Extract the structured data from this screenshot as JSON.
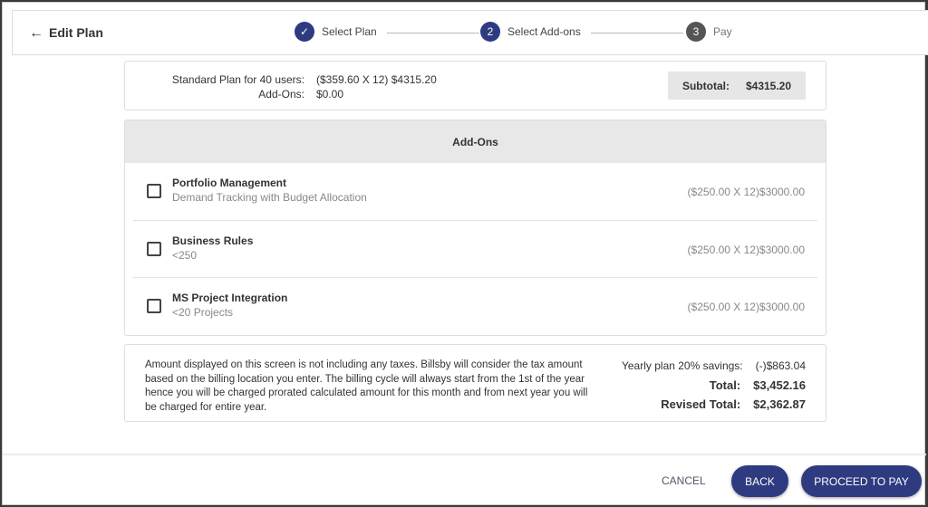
{
  "header": {
    "back_label": "Edit Plan",
    "steps": [
      {
        "num": "✓",
        "label": "Select Plan"
      },
      {
        "num": "2",
        "label": "Select Add-ons"
      },
      {
        "num": "3",
        "label": "Pay"
      }
    ]
  },
  "summary": {
    "plan_label": "Standard Plan for 40 users:",
    "plan_value": "($359.60 X 12) $4315.20",
    "addons_label": "Add-Ons:",
    "addons_value": "$0.00",
    "subtotal_label": "Subtotal:",
    "subtotal_value": "$4315.20"
  },
  "addons": {
    "title": "Add-Ons",
    "items": [
      {
        "name": "Portfolio Management",
        "desc": "Demand Tracking with Budget Allocation",
        "price": "($250.00 X 12)$3000.00",
        "checked": false
      },
      {
        "name": "Business Rules",
        "desc": "<250",
        "price": "($250.00 X 12)$3000.00",
        "checked": false
      },
      {
        "name": "MS Project Integration",
        "desc": "<20 Projects",
        "price": "($250.00 X 12)$3000.00",
        "checked": false
      }
    ]
  },
  "totals": {
    "note": "Amount displayed on this screen is not including any taxes. Billsby will consider the tax amount based on the billing location you enter. The billing cycle will always start from the 1st of the year hence you will be charged prorated calculated amount for this month and from next year you will be charged for entire year.",
    "savings_label": "Yearly plan 20% savings:",
    "savings_value": "(-)$863.04",
    "total_label": "Total:",
    "total_value": "$3,452.16",
    "revised_label": "Revised Total:",
    "revised_value": "$2,362.87"
  },
  "footer": {
    "cancel": "CANCEL",
    "back": "BACK",
    "proceed": "PROCEED TO PAY"
  },
  "colors": {
    "primary": "#2f3b80"
  }
}
